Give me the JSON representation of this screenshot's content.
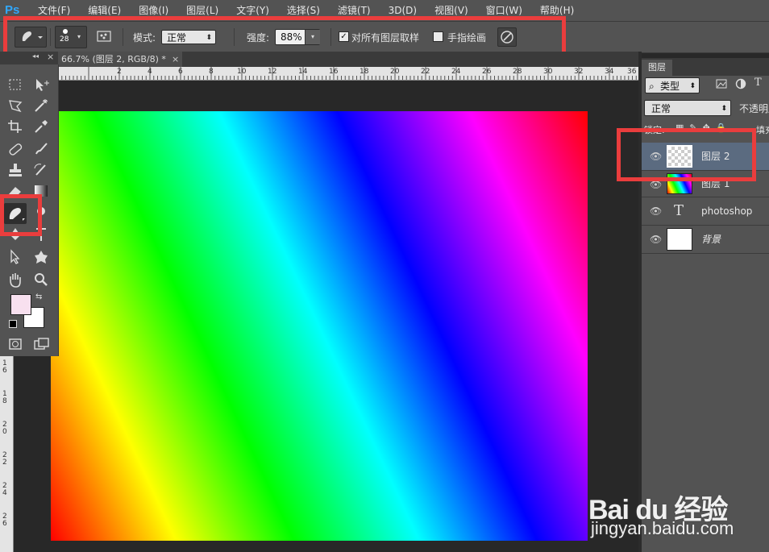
{
  "app": {
    "logo": "Ps"
  },
  "menubar": {
    "items": [
      "文件(F)",
      "编辑(E)",
      "图像(I)",
      "图层(L)",
      "文字(Y)",
      "选择(S)",
      "滤镜(T)",
      "3D(D)",
      "视图(V)",
      "窗口(W)",
      "帮助(H)"
    ]
  },
  "options": {
    "brush_size": "28",
    "mode_label": "模式:",
    "mode_value": "正常",
    "strength_label": "强度:",
    "strength_value": "88%",
    "sample_all_label": "对所有图层取样",
    "sample_all_checked": "✓",
    "finger_paint_label": "手指绘画"
  },
  "document": {
    "tab_title": "66.7% (图层 2, RGB/8) *",
    "close_glyph": "×",
    "ruler_top_labels": [
      "2",
      "4",
      "6",
      "8",
      "10",
      "12",
      "14",
      "16",
      "18",
      "20",
      "22",
      "24",
      "26",
      "28",
      "30",
      "32",
      "34",
      "36"
    ],
    "ruler_left_labels": [
      "1 6",
      "1 8",
      "2 0",
      "2 2",
      "2 4",
      "2 6"
    ]
  },
  "toolbox": {
    "collapse_glyph": "◂◂",
    "close_glyph": "×",
    "foreground_color": "#f8e0ef",
    "background_color": "#ffffff"
  },
  "layers_panel": {
    "tab_label": "图层",
    "filter_label": "类型",
    "blend_mode": "正常",
    "opacity_label": "不透明度",
    "lock_label": "锁定:",
    "fill_label": "填充",
    "layers": [
      {
        "name": "图层 2",
        "selected": true
      },
      {
        "name": "图层 1",
        "selected": false
      },
      {
        "name": "photoshop",
        "selected": false
      },
      {
        "name": "背景",
        "selected": false
      }
    ]
  },
  "watermark": {
    "logo": "Bai du 经验",
    "url": "jingyan.baidu.com"
  },
  "colors": {
    "annotation_red": "#ea3d3d",
    "ps_blue": "#31a8ff",
    "selected_layer": "#5b6b80"
  }
}
